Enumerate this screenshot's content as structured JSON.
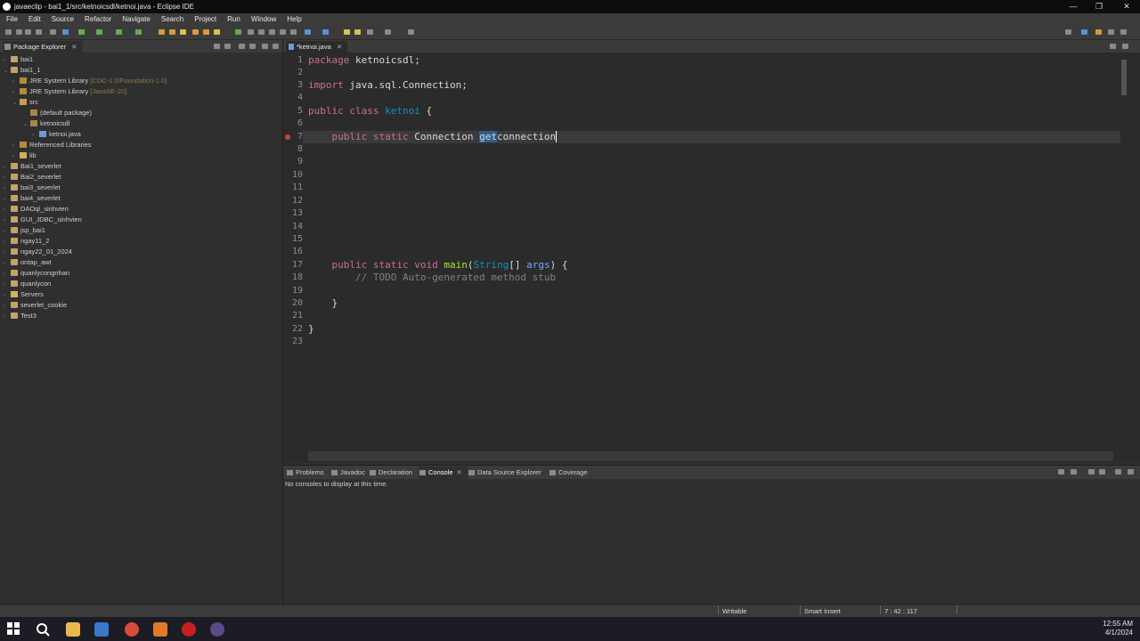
{
  "window": {
    "title": "javaeclip - bai1_1/src/ketnoicsdl/ketnoi.java - Eclipse IDE",
    "controls": [
      "—",
      "❐",
      "✕"
    ]
  },
  "menu": [
    "File",
    "Edit",
    "Source",
    "Refactor",
    "Navigate",
    "Search",
    "Project",
    "Run",
    "Window",
    "Help"
  ],
  "package_explorer": {
    "tab_label": "Package Explorer",
    "items": [
      {
        "label": "bai1",
        "decoration": ""
      },
      {
        "label": "bai1_1",
        "decoration": ""
      },
      {
        "label": "JRE System Library",
        "decoration": "[CDC-1.0/Foundation-1.0]"
      },
      {
        "label": "JRE System Library",
        "decoration": "[JavaSE-20]"
      },
      {
        "label": "src",
        "decoration": ""
      },
      {
        "label": "(default package)",
        "decoration": ""
      },
      {
        "label": "ketnoicsdl",
        "decoration": ""
      },
      {
        "label": "ketnoi.java",
        "decoration": ""
      },
      {
        "label": "Referenced Libraries",
        "decoration": ""
      },
      {
        "label": "lib",
        "decoration": ""
      },
      {
        "label": "Bai1_severlet",
        "decoration": ""
      },
      {
        "label": "Bai2_severlet",
        "decoration": ""
      },
      {
        "label": "bai3_severlet",
        "decoration": ""
      },
      {
        "label": "bai4_severlet",
        "decoration": ""
      },
      {
        "label": "DAOql_sinhvien",
        "decoration": ""
      },
      {
        "label": "GUI_JDBC_sinhvien",
        "decoration": ""
      },
      {
        "label": "jsp_bai1",
        "decoration": ""
      },
      {
        "label": "ngay11_2",
        "decoration": ""
      },
      {
        "label": "ngay22_01_2024",
        "decoration": ""
      },
      {
        "label": "ontap_awt",
        "decoration": ""
      },
      {
        "label": "quanlycongnhan",
        "decoration": ""
      },
      {
        "label": "quanlycon",
        "decoration": ""
      },
      {
        "label": "Servers",
        "decoration": ""
      },
      {
        "label": "severlet_cookie",
        "decoration": ""
      },
      {
        "label": "Test3",
        "decoration": ""
      }
    ]
  },
  "editor": {
    "tab_label": "*ketnoi.java",
    "line_numbers": [
      "1",
      "2",
      "3",
      "4",
      "5",
      "6",
      "7",
      "8",
      "9",
      "10",
      "11",
      "12",
      "13",
      "14",
      "15",
      "16",
      "17",
      "18",
      "19",
      "20",
      "21",
      "22",
      "23"
    ],
    "lines": {
      "l1_kw": "package",
      "l1_rest": " ketnoicsdl;",
      "l3_kw": "import",
      "l3_rest": " java.sql.Connection;",
      "l5_kw": "public class",
      "l5_cls": "ketnoi",
      "l5_rest": " {",
      "l7_kw": "public static",
      "l7_type": " Connection ",
      "l7_hl": "get",
      "l7_rest": "connection",
      "l17_kw": "public static void",
      "l17_method": "main",
      "l17_open": "(",
      "l17_type": "String",
      "l17_arr": "[] ",
      "l17_param": "args",
      "l17_close": ") {",
      "l18_comment": "// TODO Auto-generated method stub",
      "l20": "}",
      "l22": "}"
    }
  },
  "bottom_panel": {
    "tabs": [
      "Problems",
      "Javadoc",
      "Declaration",
      "Console",
      "Data Source Explorer",
      "Coverage"
    ],
    "active_tab": "Console",
    "message": "No consoles to display at this time."
  },
  "status": {
    "writable": "Writable",
    "insert_mode": "Smart Insert",
    "position": "7 : 42 : 117"
  },
  "taskbar": {
    "time": "12:55 AM",
    "date": "4/1/2024"
  },
  "colors": {
    "keyword": "#cc6c9c",
    "class_name": "#1290c3",
    "method": "#a7ec21",
    "comment": "#808080",
    "editor_bg": "#2b2b2b"
  }
}
